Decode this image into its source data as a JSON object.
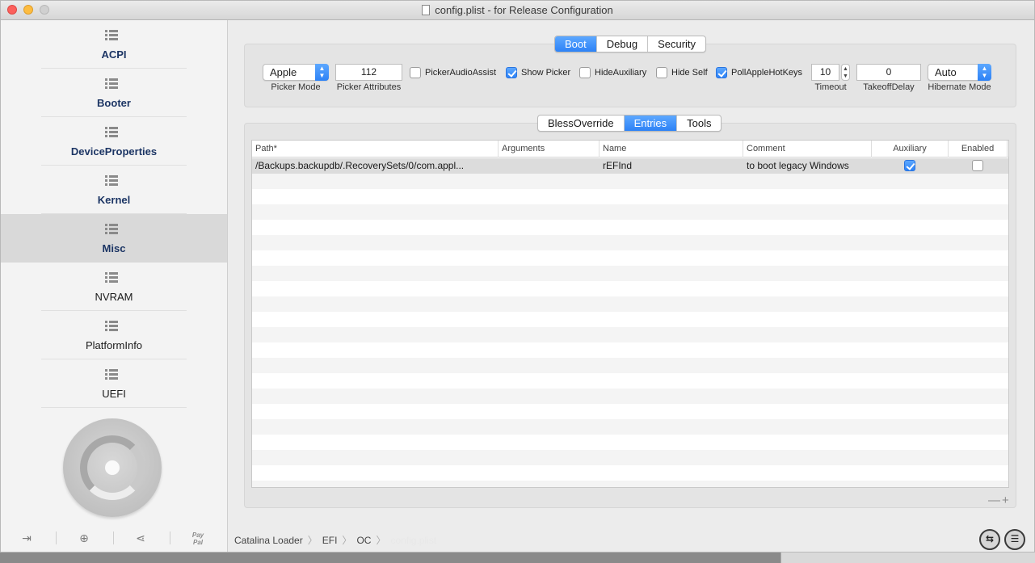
{
  "window": {
    "title": "config.plist - for Release Configuration"
  },
  "sidebar": {
    "items": [
      {
        "label": "ACPI"
      },
      {
        "label": "Booter"
      },
      {
        "label": "DeviceProperties"
      },
      {
        "label": "Kernel"
      },
      {
        "label": "Misc"
      },
      {
        "label": "NVRAM"
      },
      {
        "label": "PlatformInfo"
      },
      {
        "label": "UEFI"
      }
    ],
    "selected": "Misc",
    "bottom_tools": {
      "paypal_label_1": "Pay",
      "paypal_label_2": "Pal"
    }
  },
  "top_tabs": {
    "items": [
      "Boot",
      "Debug",
      "Security"
    ],
    "selected": "Boot"
  },
  "boot": {
    "picker_mode": {
      "value": "Apple",
      "caption": "Picker Mode"
    },
    "picker_attributes": {
      "value": "112",
      "caption": "Picker Attributes"
    },
    "checkboxes": [
      {
        "label": "PickerAudioAssist",
        "checked": false
      },
      {
        "label": "Show Picker",
        "checked": true
      },
      {
        "label": "HideAuxiliary",
        "checked": false
      },
      {
        "label": "Hide Self",
        "checked": false
      },
      {
        "label": "PollAppleHotKeys",
        "checked": true
      }
    ],
    "timeout": {
      "value": "10",
      "caption": "Timeout"
    },
    "takeoff_delay": {
      "value": "0",
      "caption": "TakeoffDelay"
    },
    "hibernate_mode": {
      "value": "Auto",
      "caption": "Hibernate Mode"
    }
  },
  "sub_tabs": {
    "items": [
      "BlessOverride",
      "Entries",
      "Tools"
    ],
    "selected": "Entries"
  },
  "entries_table": {
    "columns": [
      "Path*",
      "Arguments",
      "Name",
      "Comment",
      "Auxiliary",
      "Enabled"
    ],
    "rows": [
      {
        "path": "/Backups.backupdb/.RecoverySets/0/com.appl...",
        "arguments": "",
        "name": "rEFInd",
        "comment": "to boot legacy Windows",
        "auxiliary": true,
        "enabled": false
      }
    ],
    "remove_label": "—",
    "add_label": "+"
  },
  "breadcrumb": [
    "Catalina Loader",
    "EFI",
    "OC",
    "config.plist"
  ],
  "bottom_buttons": {
    "sync_icon": "⇆",
    "list_icon": "☰"
  }
}
